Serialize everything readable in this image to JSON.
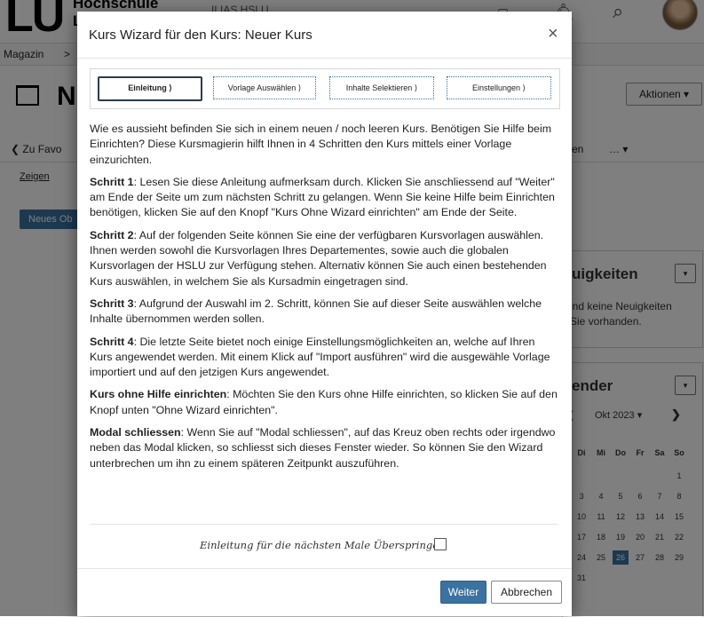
{
  "background": {
    "logo_text": "LU",
    "school_text": "Hochschule",
    "school_text_line2": "L",
    "ilias_text": "ILIAS HSLU",
    "breadcrumb": [
      "Magazin",
      ">"
    ],
    "page_title": "N",
    "actions_label": "Aktionen ▾",
    "back_link": "❮ Zu Favo",
    "tab_right": "en",
    "tab_more": "… ▾",
    "zeigen_link": "Zeigen",
    "new_object_button": "Neues Ob",
    "news_panel": {
      "heading": "uigkeiten",
      "toggle": "▾",
      "text": "ind keine Neuigkeiten\nSie vorhanden."
    },
    "calendar_panel": {
      "heading": "ender",
      "toggle": "▾",
      "month": "Okt 2023 ▾",
      "next": "❯",
      "prev": "❮",
      "weekdays": [
        "Di",
        "Mi",
        "Do",
        "Fr",
        "Sa",
        "So"
      ],
      "rows": [
        [
          "",
          "",
          "",
          "",
          "",
          "1"
        ],
        [
          "3",
          "4",
          "5",
          "6",
          "7",
          "8"
        ],
        [
          "10",
          "11",
          "12",
          "13",
          "14",
          "15"
        ],
        [
          "17",
          "18",
          "19",
          "20",
          "21",
          "22"
        ],
        [
          "24",
          "25",
          "26",
          "27",
          "28",
          "29"
        ],
        [
          "31",
          "",
          "",
          "",
          "",
          ""
        ]
      ],
      "today": "26"
    }
  },
  "modal": {
    "title": "Kurs Wizard für den Kurs: Neuer Kurs",
    "close": "×",
    "steps": [
      {
        "label": "Einleitung ⟩",
        "active": true
      },
      {
        "label": "Vorlage Auswählen ⟩",
        "active": false
      },
      {
        "label": "Inhalte Selektieren ⟩",
        "active": false
      },
      {
        "label": "Einstellungen ⟩",
        "active": false
      }
    ],
    "intro": "Wie es aussieht befinden Sie sich in einem neuen / noch leeren Kurs. Benötigen Sie Hilfe beim Einrichten? Diese Kursmagierin hilft Ihnen in 4 Schritten den Kurs mittels einer Vorlage einzurichten.",
    "paragraphs": [
      {
        "label": "Schritt 1",
        "text": ": Lesen Sie diese Anleitung aufmerksam durch. Klicken Sie anschliessend auf \"Weiter\" am Ende der Seite um zum nächsten Schritt zu gelangen. Wenn Sie keine Hilfe beim Einrichten benötigen, klicken Sie auf den Knopf \"Kurs Ohne Wizard einrichten\" am Ende der Seite."
      },
      {
        "label": "Schritt 2",
        "text": ": Auf der folgenden Seite können Sie eine der verfügbaren Kursvorlagen auswählen. Ihnen werden sowohl die Kursvorlagen Ihres Departementes, sowie auch die globalen Kursvorlagen der HSLU zur Verfügung stehen. Alternativ können Sie auch einen bestehenden Kurs auswählen, in welchem Sie als Kursadmin eingetragen sind."
      },
      {
        "label": "Schritt 3",
        "text": ": Aufgrund der Auswahl im 2. Schritt, können Sie auf dieser Seite auswählen welche Inhalte übernommen werden sollen."
      },
      {
        "label": "Schritt 4",
        "text": ": Die letzte Seite bietet noch einige Einstellungsmöglichkeiten an, welche auf Ihren Kurs angewendet werden. Mit einem Klick auf \"Import ausführen\" wird die ausgewähle Vorlage importiert und auf den jetzigen Kurs angewendet."
      },
      {
        "label": "Kurs ohne Hilfe einrichten",
        "text": ": Möchten Sie den Kurs ohne Hilfe einrichten, so klicken Sie auf den Knopf unten \"Ohne Wizard einrichten\"."
      },
      {
        "label": "Modal schliessen",
        "text": ": Wenn Sie auf \"Modal schliessen\", auf das Kreuz oben rechts oder irgendwo neben das Modal klicken, so schliesst sich dieses Fenster wieder. So können Sie den Wizard unterbrechen um ihn zu einem späteren Zeitpunkt auszuführen."
      }
    ],
    "skip_label": "Einleitung für die nächsten Male Überspringen",
    "next_button": "Weiter",
    "cancel_button": "Abbrechen"
  },
  "colors": {
    "primary": "#3b72a0",
    "overlay": "rgba(0,0,0,0.5)"
  }
}
